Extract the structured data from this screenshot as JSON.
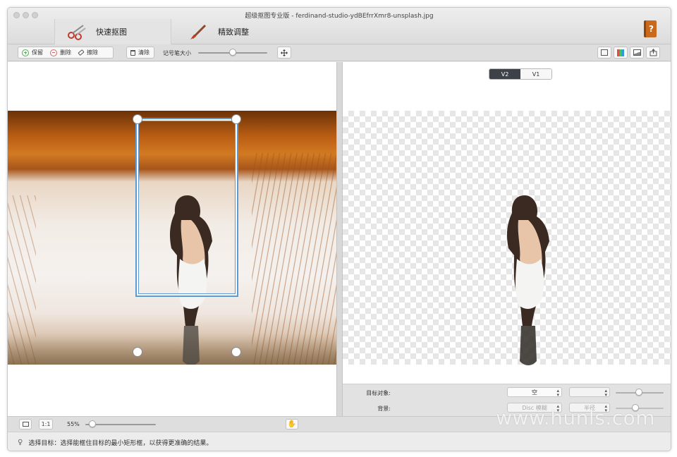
{
  "window": {
    "title": "超级抠图专业版 - ferdinand-studio-ydBEfrrXmr8-unsplash.jpg"
  },
  "tabs": [
    {
      "label": "快速抠图",
      "icon": "scissors-icon",
      "active": true
    },
    {
      "label": "精致调整",
      "icon": "brush-icon",
      "active": false
    }
  ],
  "help": {
    "icon": "help-book-icon",
    "glyph": "?"
  },
  "toolbar": {
    "keep_label": "保留",
    "delete_label": "删除",
    "erase_label": "擦除",
    "clear_label": "清除",
    "brush_size_label": "记号笔大小",
    "brush_size_fraction": 0.5,
    "right_icons": [
      "fit-view-icon",
      "color-palette-icon",
      "image-icon",
      "export-icon"
    ]
  },
  "version_toggle": {
    "options": [
      "V2",
      "V1"
    ],
    "selected": "V2"
  },
  "properties": {
    "target_label": "目标对象:",
    "target_value": "空",
    "background_label": "背景:",
    "background_value": "Disc 模糊",
    "radius_label": "半径"
  },
  "bottom": {
    "one_to_one_label": "1:1",
    "zoom_label": "55%",
    "zoom_fraction": 0.1
  },
  "status": {
    "text": "选择目标：选择能框住目标的最小矩形框，以获得更准确的结果。"
  },
  "watermark": "www.hunls.com",
  "colors": {
    "selection": "#5b9bd5",
    "seg_selected": "#3d4148",
    "help_book": "#c8691b"
  }
}
